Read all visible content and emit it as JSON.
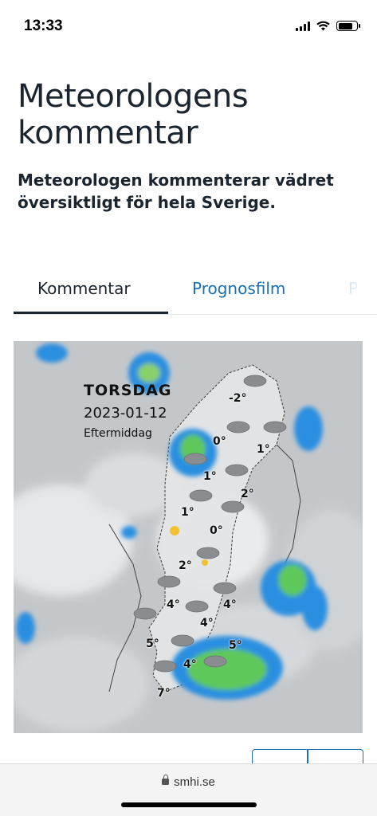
{
  "status_bar": {
    "time": "13:33"
  },
  "header": {
    "title": "Meteorologens kommentar",
    "subtitle": "Meteorologen kommenterar vädret översiktligt för hela Sverige."
  },
  "tabs": [
    {
      "label": "Kommentar"
    },
    {
      "label": "Prognosfilm"
    },
    {
      "label": "P"
    }
  ],
  "map": {
    "day": "TORSDAG",
    "date": "2023-01-12",
    "time_of_day": "Eftermiddag",
    "temperatures": [
      {
        "label": "-2°"
      },
      {
        "label": "0°"
      },
      {
        "label": "1°"
      },
      {
        "label": "1°"
      },
      {
        "label": "2°"
      },
      {
        "label": "1°"
      },
      {
        "label": "0°"
      },
      {
        "label": "2°"
      },
      {
        "label": "4°"
      },
      {
        "label": "4°"
      },
      {
        "label": "4°"
      },
      {
        "label": "5°"
      },
      {
        "label": "5°"
      },
      {
        "label": "4°"
      },
      {
        "label": "7°"
      }
    ]
  },
  "browser": {
    "url": "smhi.se"
  },
  "colors": {
    "accent": "#1a6fb5",
    "text": "#1a2530"
  }
}
